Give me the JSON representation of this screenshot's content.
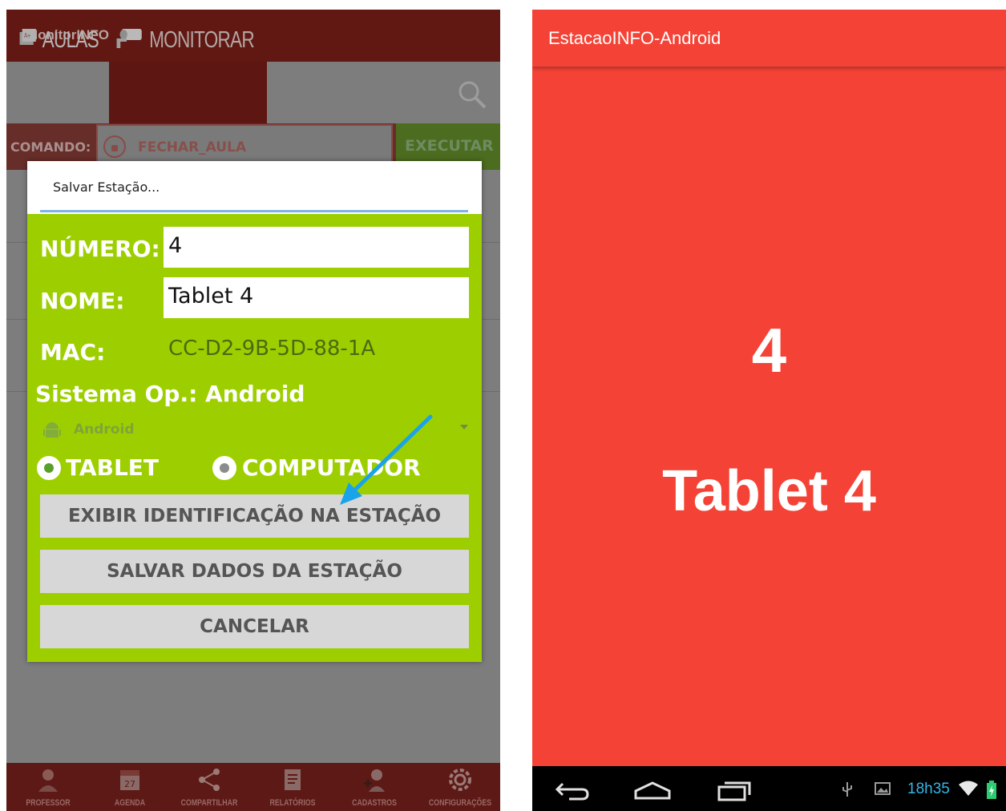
{
  "left_app": {
    "title": "MonitorINFO",
    "tabs": [
      {
        "label": "AULAS",
        "icon": "classes-icon",
        "active": false
      },
      {
        "label": "MONITORAR",
        "icon": "camera-icon",
        "active": true
      }
    ],
    "command_label": "COMANDO:",
    "command_value": "FECHAR_AULA",
    "execute_label": "EXECUTAR",
    "bottom_nav": [
      {
        "label": "PROFESSOR",
        "icon": "teacher-icon"
      },
      {
        "label": "AGENDA",
        "icon": "calendar-icon"
      },
      {
        "label": "COMPARTILHAR",
        "icon": "share-icon"
      },
      {
        "label": "RELATÓRIOS",
        "icon": "report-icon"
      },
      {
        "label": "CADASTROS",
        "icon": "add-user-icon"
      },
      {
        "label": "CONFIGURAÇÕES",
        "icon": "gear-icon"
      }
    ],
    "calendar_day": "27"
  },
  "dialog": {
    "title": "Salvar Estação...",
    "numero_label": "NÚMERO:",
    "numero_value": "4",
    "nome_label": "NOME:",
    "nome_value": "Tablet 4",
    "mac_label": "MAC:",
    "mac_value": "CC-D2-9B-5D-88-1A",
    "so_label": "Sistema Op.: Android",
    "so_select": "Android",
    "radio_tablet": "TABLET",
    "radio_computador": "COMPUTADOR",
    "selected_type": "TABLET",
    "btn_exibir": "EXIBIR IDENTIFICAÇÃO NA ESTAÇÃO",
    "btn_salvar": "SALVAR DADOS DA ESTAÇÃO",
    "btn_cancelar": "CANCELAR"
  },
  "right_app": {
    "title": "EstacaoINFO-Android",
    "station_number": "4",
    "station_name": "Tablet 4",
    "clock": "18h35"
  },
  "colors": {
    "dialog_green": "#9dcf00",
    "right_red": "#f44336",
    "annotation_arrow": "#1aa3e8"
  }
}
